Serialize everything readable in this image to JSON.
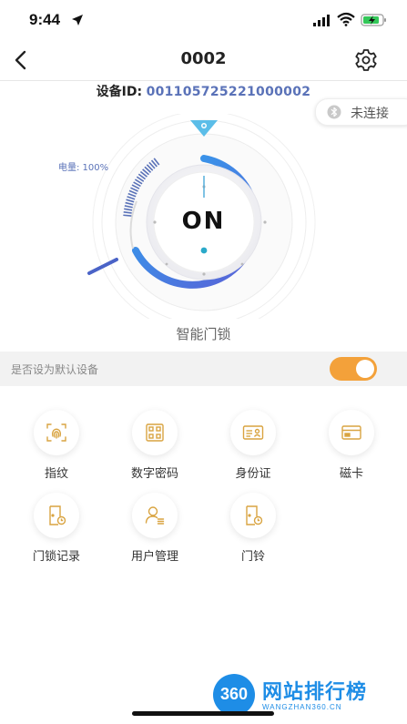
{
  "status_bar": {
    "time": "9:44"
  },
  "nav": {
    "title": "0002"
  },
  "device": {
    "id_label": "设备ID:",
    "id_value": "001105725221000002",
    "name": "智能门锁"
  },
  "bluetooth": {
    "status": "未连接"
  },
  "lock": {
    "state": "ON",
    "battery_label": "电量: 100%",
    "battery_level": 1.0
  },
  "default_device": {
    "label": "是否设为默认设备",
    "enabled": true
  },
  "functions": [
    {
      "label": "指纹",
      "icon": "fingerprint-icon"
    },
    {
      "label": "数字密码",
      "icon": "keypad-icon"
    },
    {
      "label": "身份证",
      "icon": "id-card-icon"
    },
    {
      "label": "磁卡",
      "icon": "card-icon"
    },
    {
      "label": "门锁记录",
      "icon": "lock-record-icon"
    },
    {
      "label": "用户管理",
      "icon": "user-manage-icon"
    },
    {
      "label": "门铃",
      "icon": "doorbell-icon"
    }
  ],
  "watermark": {
    "logo_text": "360",
    "name": "网站排行榜",
    "url": "WANGZHAN360.CN"
  },
  "colors": {
    "accent": "#f3a13a",
    "blue": "#3f8fe6",
    "icon_gold": "#d9a441",
    "id_blue": "#5a72b8"
  }
}
